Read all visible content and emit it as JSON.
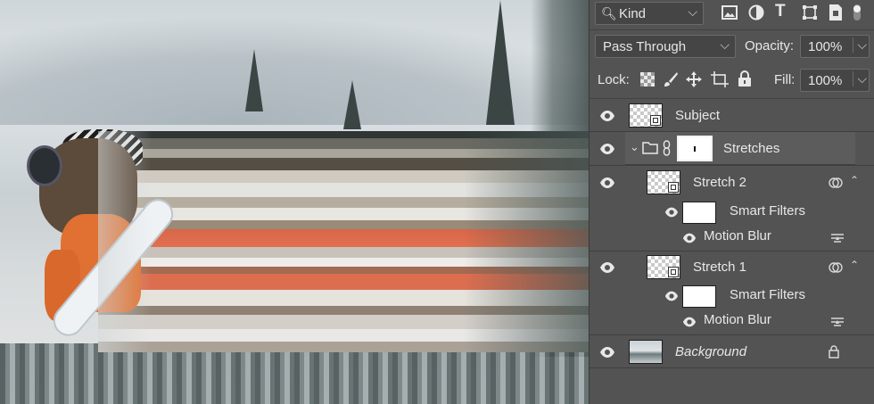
{
  "panel": {
    "filter": {
      "kind_label": "Kind"
    },
    "blend_mode": "Pass Through",
    "opacity_label": "Opacity:",
    "opacity_value": "100%",
    "lock_label": "Lock:",
    "fill_label": "Fill:",
    "fill_value": "100%"
  },
  "layers": [
    {
      "name": "Subject"
    },
    {
      "name": "Stretches"
    },
    {
      "name": "Stretch 2"
    },
    {
      "name": "Smart Filters"
    },
    {
      "name": "Motion Blur"
    },
    {
      "name": "Stretch 1"
    },
    {
      "name": "Smart Filters"
    },
    {
      "name": "Motion Blur"
    },
    {
      "name": "Background"
    }
  ],
  "colors": {
    "panel_bg": "#535353",
    "selected_row": "#5c5c5c",
    "accent_orange": "#e07132"
  }
}
